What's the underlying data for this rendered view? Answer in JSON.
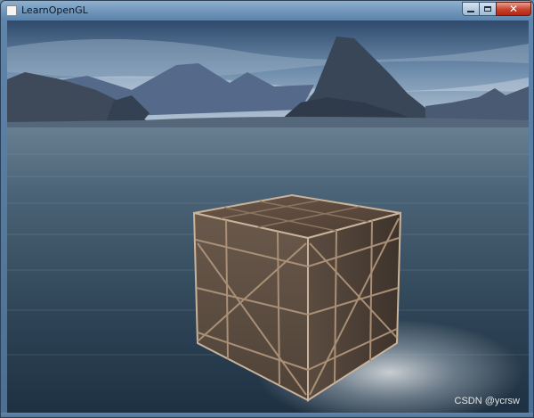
{
  "window": {
    "title": "LearnOpenGL",
    "controls": {
      "minimize": "minimize",
      "maximize": "maximize",
      "close": "✕"
    }
  },
  "scene": {
    "sky_colors": [
      "#2f4a6c",
      "#6c8bab",
      "#b9c9d6"
    ],
    "water_colors": [
      "#4b6376",
      "#2c4254",
      "#1e3142"
    ],
    "mountain_color": "#3d4d66",
    "crate_colors": {
      "top": "#5b4a3e",
      "front": "#5e4f42",
      "side": "#4e4036",
      "plank": "#c9b39a"
    }
  },
  "watermark": "CSDN @ycrsw"
}
